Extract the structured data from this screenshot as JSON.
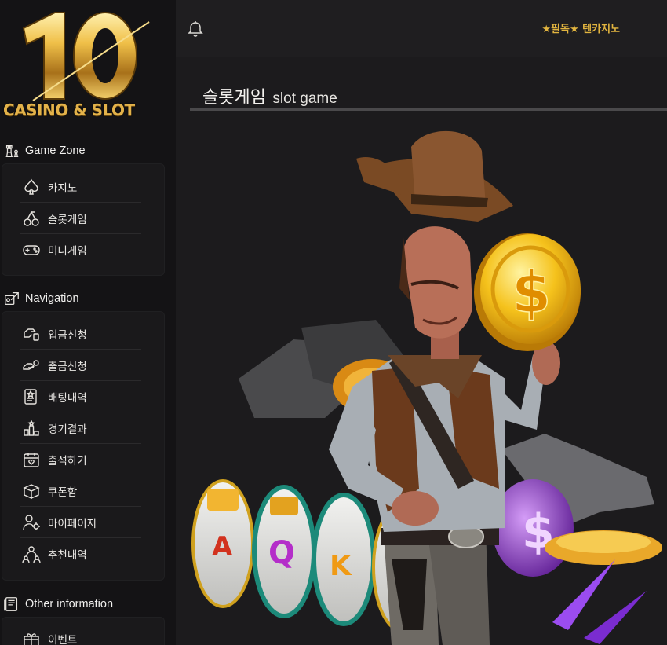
{
  "logo": {
    "number": "10",
    "caption": "CASINO & SLOT"
  },
  "header": {
    "site_title": "★필독★ 텐카지노",
    "bell_icon": "bell-icon"
  },
  "page": {
    "title_ko": "슬롯게임",
    "title_en": "slot game"
  },
  "sidebar": {
    "sections": [
      {
        "title": "Game Zone",
        "icon": "chess-icon",
        "items": [
          {
            "label": "카지노",
            "icon": "spade-icon"
          },
          {
            "label": "슬롯게임",
            "icon": "cherry-icon"
          },
          {
            "label": "미니게임",
            "icon": "gamepad-icon"
          }
        ]
      },
      {
        "title": "Navigation",
        "icon": "navigation-icon",
        "items": [
          {
            "label": "입금신청",
            "icon": "deposit-icon"
          },
          {
            "label": "출금신청",
            "icon": "withdraw-icon"
          },
          {
            "label": "배팅내역",
            "icon": "betting-history-icon"
          },
          {
            "label": "경기결과",
            "icon": "results-icon"
          },
          {
            "label": "출석하기",
            "icon": "calendar-icon"
          },
          {
            "label": "쿠폰함",
            "icon": "coupon-box-icon"
          },
          {
            "label": "마이페이지",
            "icon": "user-settings-icon"
          },
          {
            "label": "추천내역",
            "icon": "referral-icon"
          }
        ]
      },
      {
        "title": "Other information",
        "icon": "document-icon",
        "items": [
          {
            "label": "이벤트",
            "icon": "gift-icon"
          }
        ]
      }
    ]
  },
  "colors": {
    "gold": "#e1b43f",
    "background": "#1c1b1d",
    "sidebar": "#141315"
  }
}
